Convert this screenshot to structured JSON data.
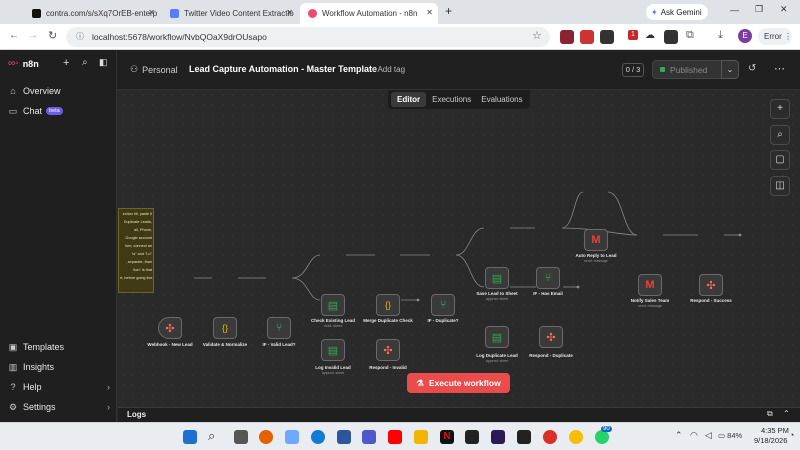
{
  "browser": {
    "tabs": [
      {
        "title": "contra.com/s/sXq7OrEB-enterp",
        "active": false
      },
      {
        "title": "Twitter Video Content Extractio",
        "active": false
      },
      {
        "title": "Workflow Automation - n8n",
        "active": true
      }
    ],
    "new_tab": "+",
    "ask_gemini": "Ask Gemini",
    "url": "localhost:5678/workflow/NvbQOaX9drOUsapo",
    "profile_initial": "E",
    "error_label": "Error",
    "ext_badge": "1"
  },
  "sidebar": {
    "brand": "n8n",
    "items": [
      {
        "label": "Overview",
        "icon": "home-icon"
      },
      {
        "label": "Chat",
        "icon": "chat-icon",
        "badge": "beta"
      }
    ],
    "bottom_items": [
      {
        "label": "Templates",
        "icon": "templates-icon"
      },
      {
        "label": "Insights",
        "icon": "insights-icon"
      },
      {
        "label": "Help",
        "icon": "help-icon"
      },
      {
        "label": "Settings",
        "icon": "settings-icon"
      }
    ]
  },
  "header": {
    "project": "Personal",
    "workflow_name": "Lead Capture Automation - Master Template",
    "add_tag": "+ Add tag",
    "counter": "0 / 3",
    "published": "Published",
    "tabs": [
      "Editor",
      "Executions",
      "Evaluations"
    ],
    "active_tab": "Editor"
  },
  "sticky": {
    "lines": [
      "ection tilt, paste it",
      "Duplicate Leads,",
      "ail, Phone,",
      "Google account",
      "ken, connect an",
      "ts\" and \"Lo\"",
      ", separate, than",
      "tion\" is that",
      "rt, before going live."
    ]
  },
  "nodes": [
    {
      "label": "Webhook - New Lead",
      "sub": ""
    },
    {
      "label": "Validate & Normalize",
      "sub": ""
    },
    {
      "label": "IF - Valid Lead?",
      "sub": ""
    },
    {
      "label": "Check Existing Lead",
      "sub": "read: sheet"
    },
    {
      "label": "Merge Duplicate Check",
      "sub": ""
    },
    {
      "label": "IF - Duplicate?",
      "sub": ""
    },
    {
      "label": "Save Lead to Sheet",
      "sub": "append: sheet"
    },
    {
      "label": "IF - Has Email",
      "sub": ""
    },
    {
      "label": "Auto Reply to Lead",
      "sub": "send: message"
    },
    {
      "label": "Notify Sales Team",
      "sub": "send: message"
    },
    {
      "label": "Respond - Success",
      "sub": ""
    },
    {
      "label": "Log Invalid Lead",
      "sub": "append: sheet"
    },
    {
      "label": "Respond - Invalid",
      "sub": ""
    },
    {
      "label": "Log Duplicate Lead",
      "sub": "append: sheet"
    },
    {
      "label": "Respond - Duplicate",
      "sub": ""
    }
  ],
  "canvas": {
    "execute_button": "Execute workflow"
  },
  "logs": {
    "label": "Logs"
  },
  "taskbar": {
    "time": "4:35 PM",
    "date": "9/18/2026",
    "battery": "84%",
    "notif_badge": "90"
  },
  "colors": {
    "accent": "#ea4b4b",
    "node_green": "#34a853",
    "node_orange": "#ff6d5a",
    "bg": "#2a2a2a"
  }
}
